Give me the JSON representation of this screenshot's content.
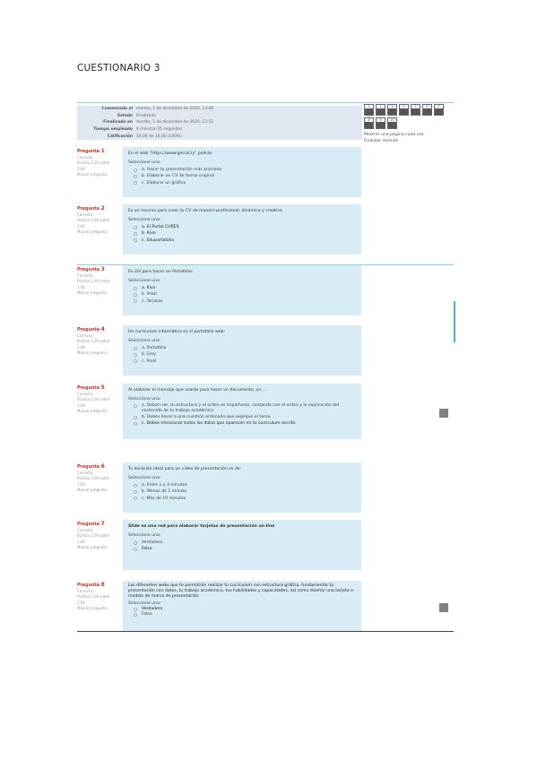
{
  "doc_title": "CUESTIONARIO 3",
  "summary": [
    {
      "k": "Comenzado el",
      "v": "martes, 1 de diciembre de 2020, 13:46"
    },
    {
      "k": "Estado",
      "v": "Finalizado"
    },
    {
      "k": "Finalizado en",
      "v": "martes, 1 de diciembre de 2020, 13:52"
    },
    {
      "k": "Tiempo empleado",
      "v": "6 minutos 25 segundos"
    },
    {
      "k": "Calificación",
      "v": "10,00 de 10,00 (100%)"
    }
  ],
  "nav": {
    "cells": [
      "1",
      "2",
      "3",
      "4",
      "5",
      "6",
      "7",
      "8",
      "9",
      "10"
    ],
    "finish_review": "Finalizar revisión",
    "show_one_page": "Mostrar una página cada vez"
  },
  "questions": [
    {
      "number": "1",
      "label": "Pregunta",
      "status": "Correcta",
      "score": "Puntúa 1,00 sobre 1,00",
      "flag": "Marcar pregunta",
      "text": "En el web \"https://www.genial.ly\" podrás",
      "select": "Seleccione una:",
      "options": [
        "a. Hacer tu presentación más animada",
        "b. Elaborar un CV de forma original",
        "c. Elaborar un gráfico"
      ]
    },
    {
      "number": "2",
      "label": "Pregunta",
      "status": "Correcta",
      "score": "Puntúa 1,00 sobre 1,00",
      "flag": "Marcar pregunta",
      "text": "Es un recurso para crear tu CV de manera profesional, dinámica y creativa",
      "select": "Seleccione una:",
      "options": [
        "a. El Portal CURES",
        "b. Kivo",
        "c. Eduportafolio"
      ]
    },
    {
      "number": "3",
      "label": "Pregunta",
      "status": "Correcta",
      "score": "Puntúa 1,00 sobre 1,00",
      "flag": "Marcar pregunta",
      "text": "Es útil para hacer un Portafolio:",
      "select": "Seleccione una:",
      "options": [
        "a. Kivo",
        "b. Prezi",
        "c. Tarjetas"
      ]
    },
    {
      "number": "4",
      "label": "Pregunta",
      "status": "Correcta",
      "score": "Puntúa 1,00 sobre 1,00",
      "flag": "Marcar pregunta",
      "text": "Un currículum informático es el portafolio web:",
      "select": "Seleccione una:",
      "options": [
        "a. Portafolio",
        "b. Emy",
        "c. Prezi"
      ]
    },
    {
      "number": "5",
      "label": "Pregunta",
      "status": "Correcta",
      "score": "Puntúa 1,00 sobre 1,00",
      "flag": "Marcar pregunta",
      "text": "Al elaborar el mensaje que usarás para hacer un documento, un ...",
      "select": "Seleccione una:",
      "options": [
        "a. Deben ser, tu estructura y el orden es importante, contando con el orden y la explicación del contenido de tu trabajo académico",
        "b. Debes llevar a una cuestión ordenada que explique el tema",
        "c. Debes mencionar todos los datos que aparecen en tu currículum escrito"
      ]
    },
    {
      "number": "6",
      "label": "Pregunta",
      "status": "Correcta",
      "score": "Puntúa 1,00 sobre 1,00",
      "flag": "Marcar pregunta",
      "text": "Tu duración ideal para un video de presentación es de:",
      "select": "Seleccione una:",
      "options": [
        "a. Entre 1 y 3 minutos",
        "b. Menos de 1 minuto",
        "c. Más de 10 minutos"
      ]
    },
    {
      "number": "7",
      "label": "Pregunta",
      "status": "Correcta",
      "score": "Puntúa 1,00 sobre 1,00",
      "flag": "Marcar pregunta",
      "text": "Slide es una red para elaborar tarjetas de presentación on-line",
      "select": "Seleccione una:",
      "options": [
        "Verdadero",
        "Falso"
      ]
    },
    {
      "number": "8",
      "label": "Pregunta",
      "status": "Correcta",
      "score": "Puntúa 1,00 sobre 1,00",
      "flag": "Marcar pregunta",
      "text": "Los diferentes webs que te permitirán realizar tu currículum con estructura gráfica, fundamentar tu presentación con datos, tu trabajo académico, tus habilidades y capacidades, así como diseñar una tarjeta o modelo de marca de presentación",
      "select": "Seleccione una:",
      "options": [
        "Verdadero",
        "Falso"
      ]
    }
  ]
}
